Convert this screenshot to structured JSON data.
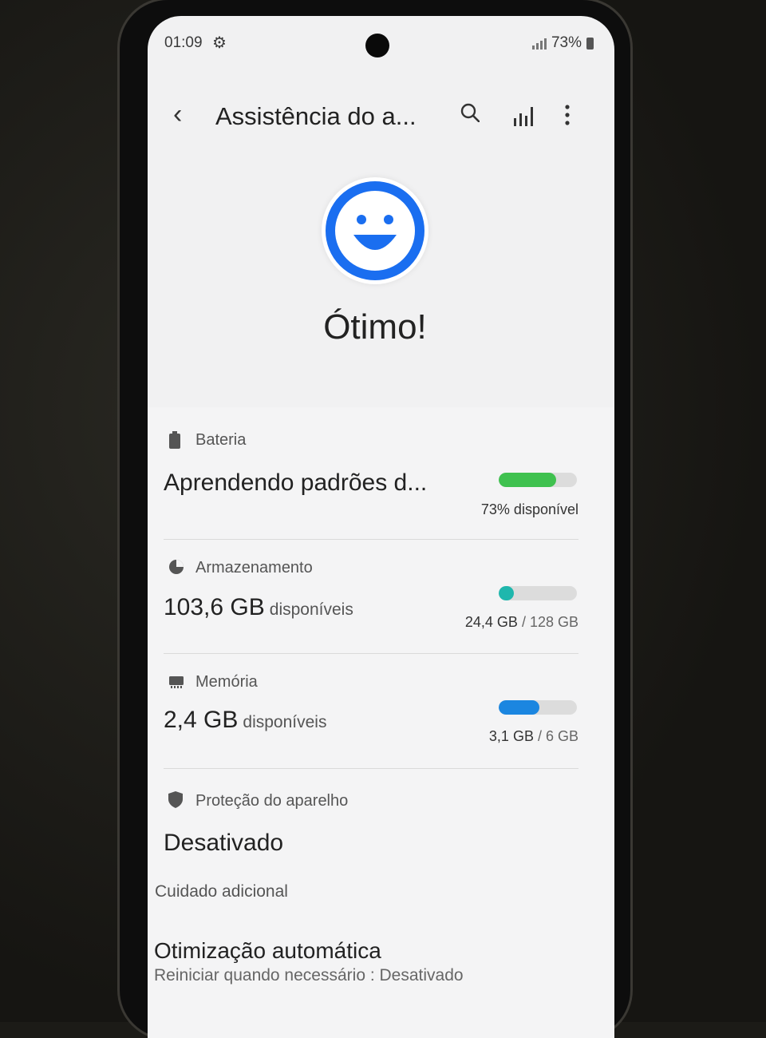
{
  "status_bar": {
    "time": "01:09",
    "battery": "73%",
    "icons": [
      "gear-icon",
      "signal-icon",
      "battery-icon"
    ]
  },
  "app_bar": {
    "title": "Assistência do a...",
    "icons": [
      "back-icon",
      "search-icon",
      "stats-icon",
      "more-options-icon"
    ]
  },
  "overall": {
    "status": "Ótimo!",
    "icon": "smiley-icon",
    "color": "#1a6ef0"
  },
  "battery": {
    "label": "Bateria",
    "value": "Aprendendo padrões d...",
    "detail": "73% disponível",
    "level": 0.73,
    "color": "#3fc14f"
  },
  "storage": {
    "label": "Armazenamento",
    "value": "103,6 GB",
    "unit": "disponíveis",
    "used": "24,4 GB",
    "total": "/ 128 GB",
    "level": 0.19,
    "color": "#1fb7ad"
  },
  "memory": {
    "label": "Memória",
    "value": "2,4 GB",
    "unit": "disponíveis",
    "used": "3,1 GB",
    "total": "/ 6 GB",
    "level": 0.52,
    "color": "#1b86e0"
  },
  "protection": {
    "label": "Proteção do aparelho",
    "value": "Desativado"
  },
  "extra_care": {
    "section_title": "Cuidado adicional",
    "auto_opt_title": "Otimização automática",
    "auto_opt_subtitle": "Reiniciar quando necessário : Desativado"
  }
}
